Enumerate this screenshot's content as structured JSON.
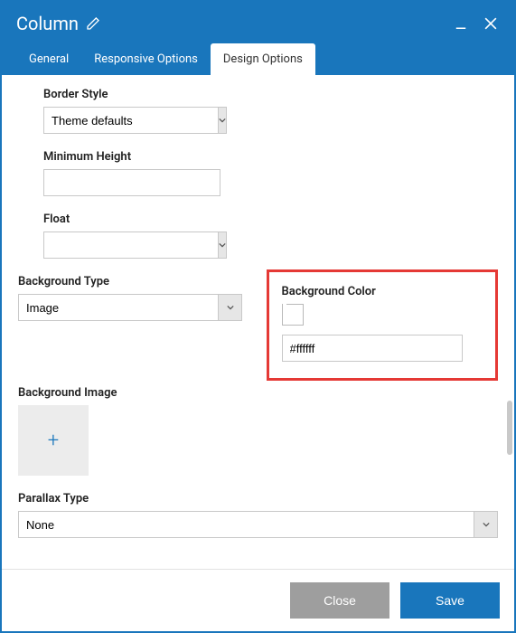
{
  "header": {
    "title": "Column",
    "minimize_aria": "Minimize",
    "close_aria": "Close"
  },
  "tabs": {
    "general": "General",
    "responsive": "Responsive Options",
    "design": "Design Options"
  },
  "fields": {
    "border_style": {
      "label": "Border Style",
      "value": "Theme defaults"
    },
    "min_height": {
      "label": "Minimum Height",
      "value": ""
    },
    "float": {
      "label": "Float",
      "value": ""
    },
    "bg_type": {
      "label": "Background Type",
      "value": "Image"
    },
    "bg_color": {
      "label": "Background Color",
      "value": "#ffffff"
    },
    "bg_image": {
      "label": "Background Image"
    },
    "parallax": {
      "label": "Parallax Type",
      "value": "None"
    }
  },
  "footer": {
    "close": "Close",
    "save": "Save"
  }
}
